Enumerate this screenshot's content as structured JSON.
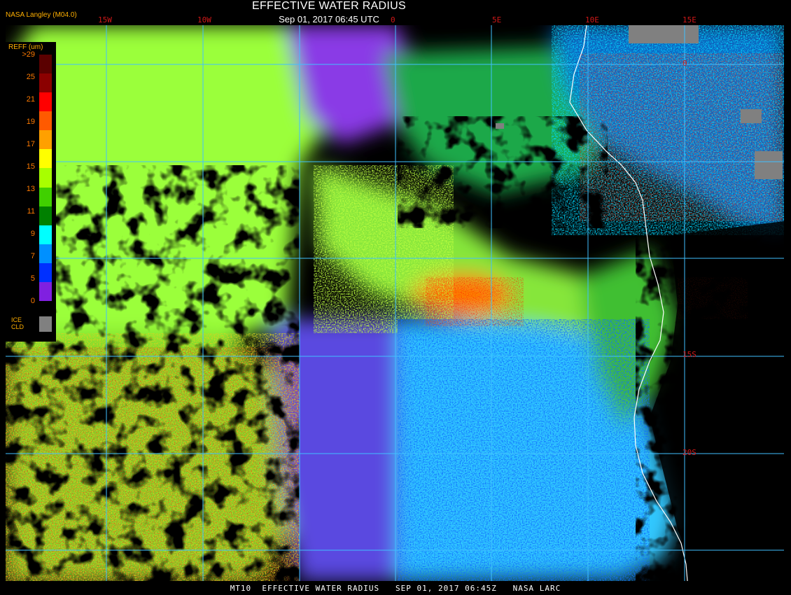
{
  "header": {
    "title": "EFFECTIVE WATER RADIUS",
    "subtitle": "Sep 01, 2017 06:45 UTC",
    "source": "NASA Langley (M04.0)"
  },
  "map": {
    "longitude_labels": [
      "15W",
      "10W",
      "0",
      "5E",
      "10E",
      "15E"
    ],
    "latitude_labels": [
      "0",
      "15S",
      "20S"
    ],
    "coastline_color": "#ffffff",
    "grid_color": "#40c0ff",
    "label_color": "#d01818"
  },
  "legend": {
    "title": "REFF (um)",
    "ticks": [
      ">29",
      "25",
      "21",
      "19",
      "17",
      "15",
      "13",
      "11",
      "9",
      "7",
      "5",
      "0"
    ],
    "colors": [
      "#5a0000",
      "#8b0000",
      "#ff0000",
      "#ff5a00",
      "#ffa000",
      "#ffff00",
      "#a8ff00",
      "#40d000",
      "#008000",
      "#00ffff",
      "#0090ff",
      "#0030ff",
      "#8020e0"
    ],
    "ice_label": "ICE\nCLD",
    "ice_color": "#808080"
  },
  "footer": {
    "text": "MT10  EFFECTIVE WATER RADIUS   SEP 01, 2017 06:45Z   NASA LARC"
  }
}
